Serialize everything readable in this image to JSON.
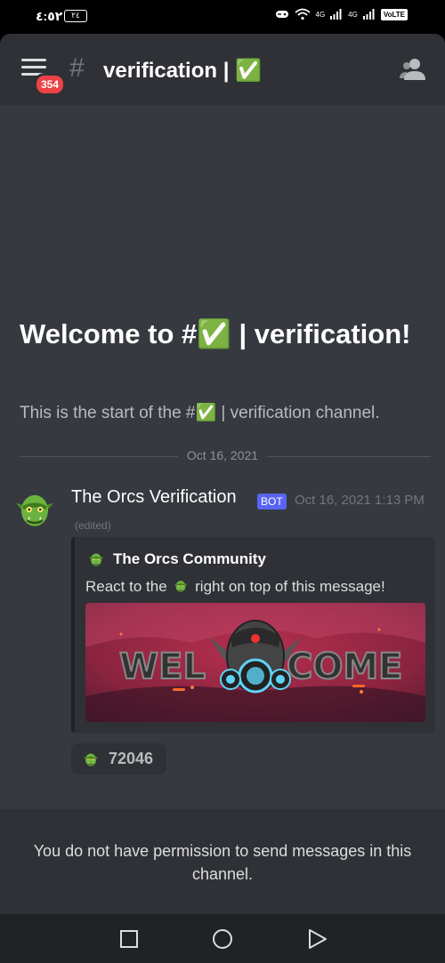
{
  "status_bar": {
    "time": "٤:٥٢",
    "battery": "٢٤",
    "network_1": "4G",
    "network_2": "4G",
    "volte": "VoLTE"
  },
  "header": {
    "unread_badge": "354",
    "hash_symbol": "#",
    "channel_title": "verification | ✅",
    "icons": [
      "menu-icon",
      "hash-icon",
      "members-icon"
    ]
  },
  "welcome": {
    "title": "Welcome to #✅ | verification!",
    "subtitle": "This is the start of the #✅ | verification channel."
  },
  "divider": {
    "date": "Oct 16, 2021"
  },
  "message": {
    "author": "The Orcs Verification",
    "bot_tag": "BOT",
    "timestamp": "Oct 16, 2021 1:13 PM",
    "edited": "(edited)",
    "embed": {
      "author": "The Orcs Community",
      "description_before": "React to the",
      "description_after": "right on top of this message!",
      "image_text_left": "WEL",
      "image_text_right": "COME"
    },
    "reaction": {
      "count": "72046"
    }
  },
  "no_permission": {
    "text": "You do not have permission to send messages in this channel."
  },
  "colors": {
    "background": "#36393f",
    "header": "#2f3136",
    "badge": "#ed4245",
    "bot_tag": "#5865f2",
    "orc_green": "#6bb33e"
  }
}
